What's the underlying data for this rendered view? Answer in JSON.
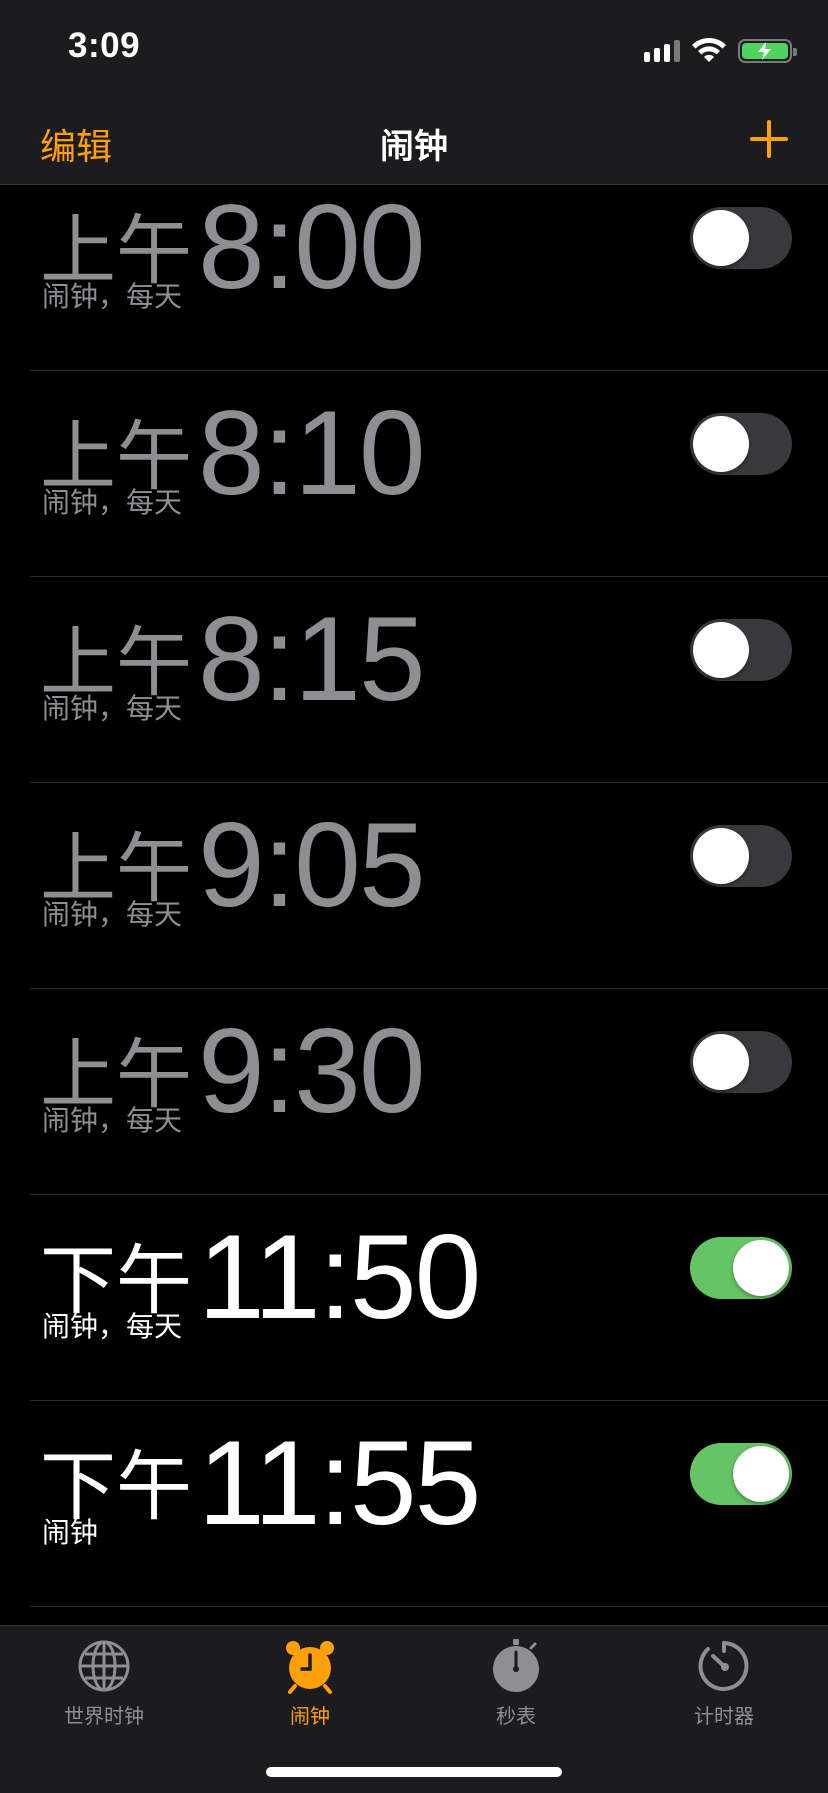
{
  "status_bar": {
    "time": "3:09"
  },
  "nav": {
    "edit_label": "编辑",
    "title": "闹钟"
  },
  "alarms": [
    {
      "period": "上午",
      "time": "8:00",
      "label": "闹钟，每天",
      "enabled": false
    },
    {
      "period": "上午",
      "time": "8:10",
      "label": "闹钟，每天",
      "enabled": false
    },
    {
      "period": "上午",
      "time": "8:15",
      "label": "闹钟，每天",
      "enabled": false
    },
    {
      "period": "上午",
      "time": "9:05",
      "label": "闹钟，每天",
      "enabled": false
    },
    {
      "period": "上午",
      "time": "9:30",
      "label": "闹钟，每天",
      "enabled": false
    },
    {
      "period": "下午",
      "time": "11:50",
      "label": "闹钟，每天",
      "enabled": true
    },
    {
      "period": "下午",
      "time": "11:55",
      "label": "闹钟",
      "enabled": true
    }
  ],
  "tabs": [
    {
      "label": "世界时钟",
      "icon": "globe-icon",
      "active": false
    },
    {
      "label": "闹钟",
      "icon": "alarm-clock-icon",
      "active": true
    },
    {
      "label": "秒表",
      "icon": "stopwatch-icon",
      "active": false
    },
    {
      "label": "计时器",
      "icon": "timer-icon",
      "active": false
    }
  ],
  "colors": {
    "accent": "#ff9f0a",
    "toggle_on": "#65c466",
    "toggle_off": "#39393d",
    "inactive_text": "#8e8e93"
  }
}
